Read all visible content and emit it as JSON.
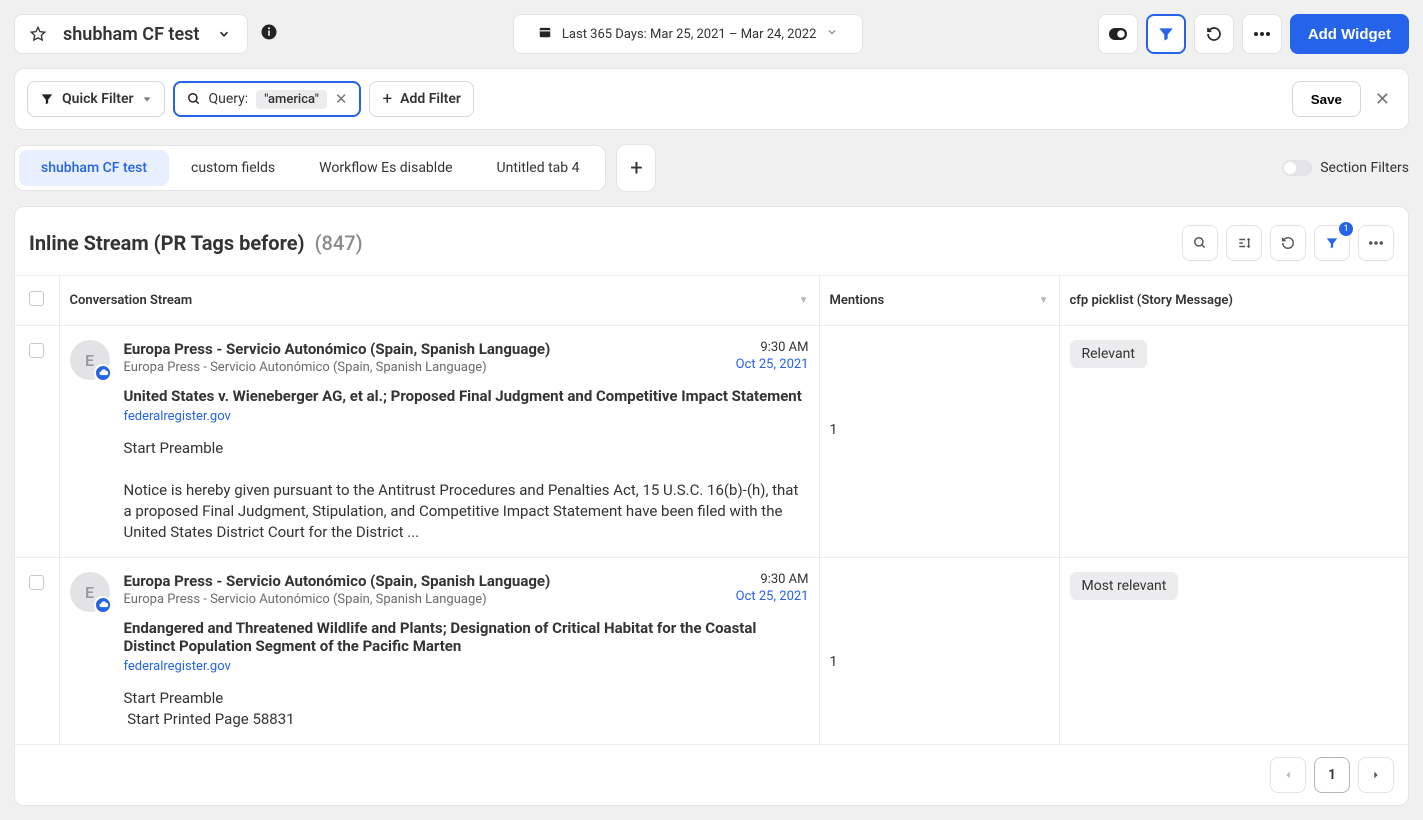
{
  "header": {
    "title": "shubham CF test",
    "date_range": "Last 365 Days: Mar 25, 2021 – Mar 24, 2022",
    "add_widget_label": "Add Widget"
  },
  "filter_bar": {
    "quick_filter_label": "Quick Filter",
    "query_label": "Query:",
    "query_value": "\"america\"",
    "add_filter_label": "Add Filter",
    "save_label": "Save"
  },
  "tabs": [
    {
      "label": "shubham CF test",
      "active": true
    },
    {
      "label": "custom fields",
      "active": false
    },
    {
      "label": "Workflow Es disablde",
      "active": false
    },
    {
      "label": "Untitled tab 4",
      "active": false
    }
  ],
  "section_filters_label": "Section Filters",
  "panel": {
    "title": "Inline Stream (PR Tags before)",
    "count": "(847)",
    "filter_badge": "1"
  },
  "columns": {
    "conversation": "Conversation Stream",
    "mentions": "Mentions",
    "picklist": "cfp picklist (Story Message)"
  },
  "rows": [
    {
      "avatar_letter": "E",
      "source": "Europa Press - Servicio Autonómico (Spain, Spanish Language)",
      "subsource": "Europa Press - Servicio Autonómico (Spain, Spanish Language)",
      "time": "9:30 AM",
      "date": "Oct 25, 2021",
      "headline": "United States v. Wieneberger AG, et al.; Proposed Final Judgment and Competitive Impact Statement",
      "link": "federalregister.gov",
      "body": "Start Preamble\n\nNotice is hereby given pursuant to the Antitrust Procedures and Penalties Act, 15 U.S.C. 16(b)-(h), that a proposed Final Judgment, Stipulation, and Competitive Impact Statement have been filed with the United States District Court for the District ...",
      "mentions": "1",
      "picklist": "Relevant"
    },
    {
      "avatar_letter": "E",
      "source": "Europa Press - Servicio Autonómico (Spain, Spanish Language)",
      "subsource": "Europa Press - Servicio Autonómico (Spain, Spanish Language)",
      "time": "9:30 AM",
      "date": "Oct 25, 2021",
      "headline": "Endangered and Threatened Wildlife and Plants; Designation of Critical Habitat for the Coastal Distinct Population Segment of the Pacific Marten",
      "link": "federalregister.gov",
      "body": "Start Preamble\n Start Printed Page 58831",
      "mentions": "1",
      "picklist": "Most relevant"
    }
  ],
  "pager": {
    "current": "1"
  }
}
